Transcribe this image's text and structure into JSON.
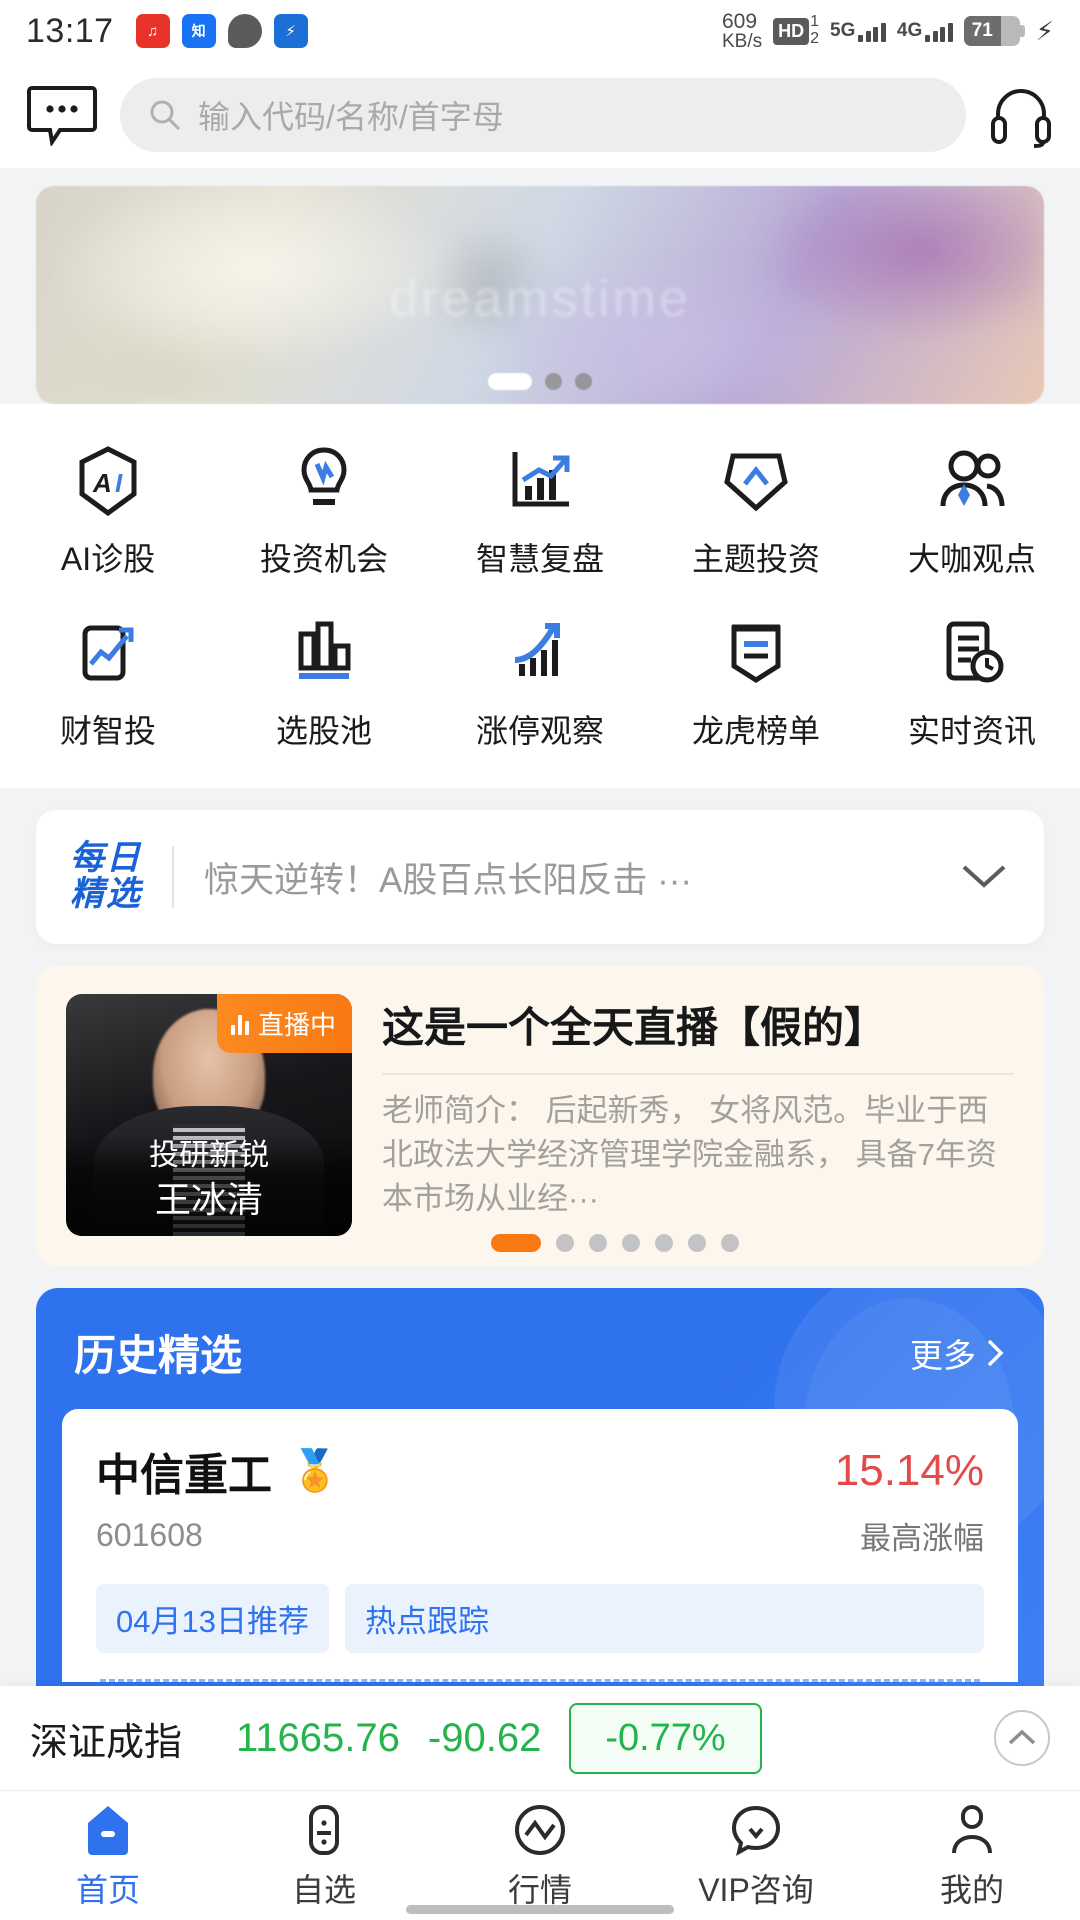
{
  "status_bar": {
    "time": "13:17",
    "app_icons": [
      "netease-music-icon",
      "zhihu-icon",
      "chat-bubble-icon",
      "app-icon"
    ],
    "app_glyphs": [
      "♫",
      "知乎",
      "",
      "⚡"
    ],
    "net_speed_value": "609",
    "net_speed_unit": "KB/s",
    "hd_label": "HD",
    "hd_sim_1": "1",
    "hd_sim_2": "2",
    "sim1_network": "5G",
    "sim2_network": "4G",
    "battery_percent": "71",
    "charging": true
  },
  "header": {
    "message_icon": "chat-bubble-icon",
    "search_placeholder": "输入代码/名称/首字母",
    "search_value": "",
    "support_icon": "headset-icon"
  },
  "banner": {
    "watermark": "dreamstime",
    "total_slides": 3,
    "active_slide": 1
  },
  "quick_actions": {
    "row1": [
      {
        "label": "AI诊股",
        "icon": "ai-hexagon-icon"
      },
      {
        "label": "投资机会",
        "icon": "lightbulb-icon"
      },
      {
        "label": "智慧复盘",
        "icon": "chart-arrow-icon"
      },
      {
        "label": "主题投资",
        "icon": "shield-chevron-icon"
      },
      {
        "label": "大咖观点",
        "icon": "people-icon"
      }
    ],
    "row2": [
      {
        "label": "财智投",
        "icon": "phone-trend-icon"
      },
      {
        "label": "选股池",
        "icon": "bar-chart-icon"
      },
      {
        "label": "涨停观察",
        "icon": "rising-bars-icon"
      },
      {
        "label": "龙虎榜单",
        "icon": "ribbon-list-icon"
      },
      {
        "label": "实时资讯",
        "icon": "news-clock-icon"
      }
    ]
  },
  "daily_pick": {
    "logo_line1": "每日",
    "logo_line2": "精选",
    "headline": "惊天逆转！A股百点长阳反击 ···",
    "expand_icon": "chevron-down-icon"
  },
  "live_card": {
    "badge_text": "直播中",
    "badge_icon": "live-bars-icon",
    "presenter_role": "投研新锐",
    "presenter_name": "王冰清",
    "title": "这是一个全天直播【假的】",
    "description": "老师简介： 后起新秀， 女将风范。毕业于西北政法大学经济管理学院金融系， 具备7年资本市场从业经···",
    "total_slides": 7,
    "active_slide": 1
  },
  "history_section": {
    "title": "历史精选",
    "more_label": "更多",
    "more_icon": "chevron-right-icon",
    "stock": {
      "name": "中信重工",
      "medal_icon": "medal-icon",
      "code": "601608",
      "change_percent": "15.14%",
      "change_label": "最高涨幅",
      "tags": [
        "04月13日推荐",
        "热点跟踪"
      ]
    }
  },
  "index_ticker": {
    "name": "深证成指",
    "price": "11665.76",
    "change": "-90.62",
    "change_percent": "-0.77%",
    "expand_icon": "chevron-up-circle-icon",
    "color_down": "#25b34b"
  },
  "tabbar": {
    "items": [
      {
        "label": "首页",
        "icon": "home-icon",
        "active": true
      },
      {
        "label": "自选",
        "icon": "watchlist-icon",
        "active": false
      },
      {
        "label": "行情",
        "icon": "quotes-icon",
        "active": false
      },
      {
        "label": "VIP咨询",
        "icon": "vip-chat-icon",
        "active": false
      },
      {
        "label": "我的",
        "icon": "profile-icon",
        "active": false
      }
    ]
  },
  "theme": {
    "accent_blue": "#2f72ee",
    "up_red": "#e34a4a",
    "down_green": "#25b34b",
    "live_orange": "#f97913"
  }
}
